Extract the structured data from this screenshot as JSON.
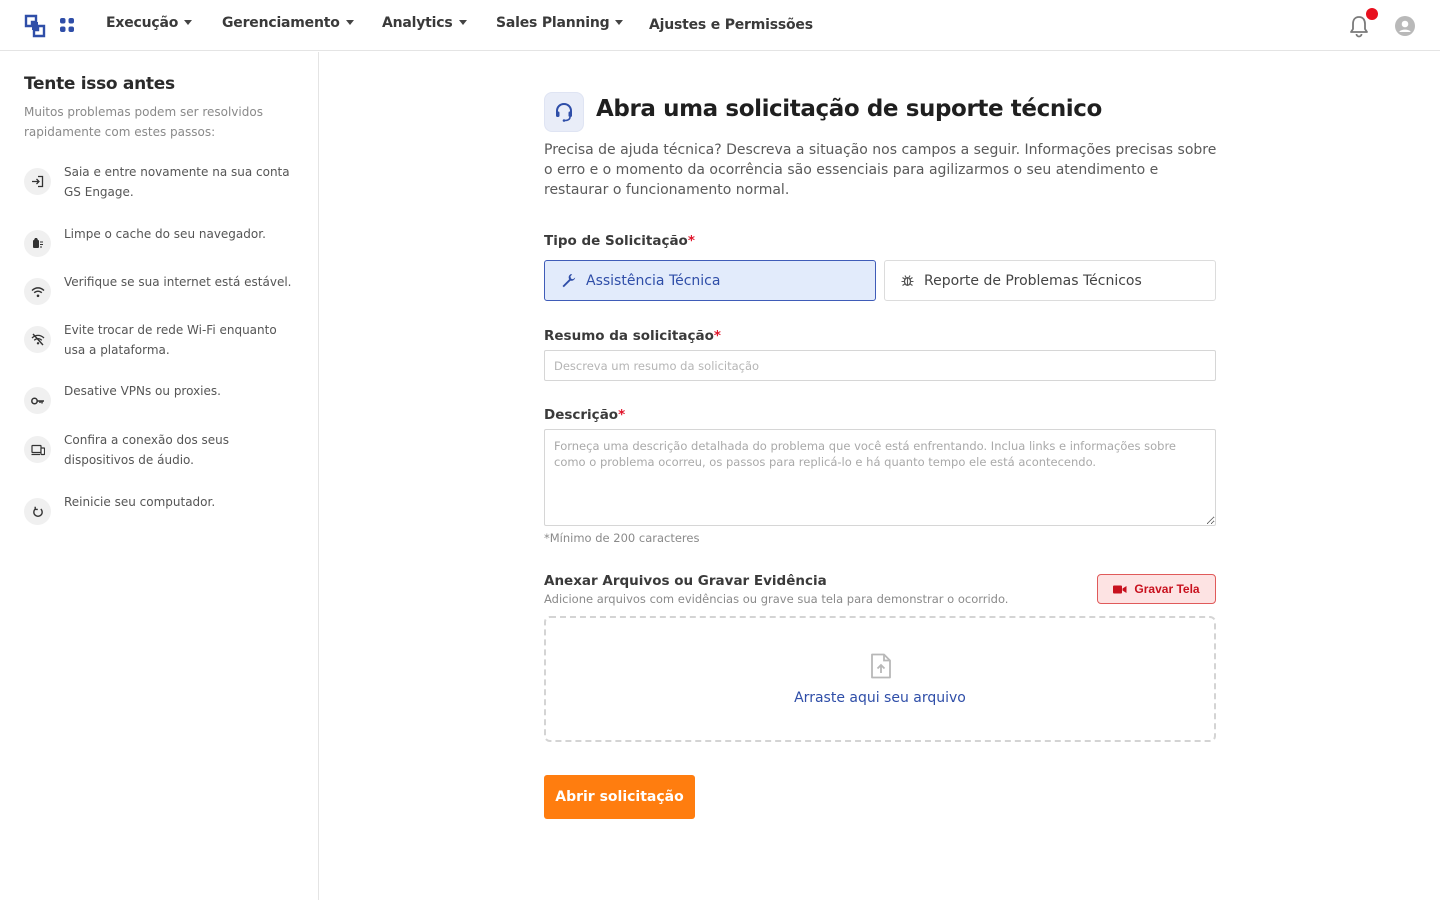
{
  "colors": {
    "brand": "#2f4ea8",
    "accent_orange": "#ff7d0f",
    "danger": "#e0142a",
    "notification_dot": "#e8101e"
  },
  "header": {
    "logo_icon": "logo-icon",
    "apps_icon": "apps-grid-icon",
    "nav": [
      {
        "label": "Execução",
        "has_dropdown": true
      },
      {
        "label": "Gerenciamento",
        "has_dropdown": true
      },
      {
        "label": "Analytics",
        "has_dropdown": true
      },
      {
        "label": "Sales Planning",
        "has_dropdown": true
      },
      {
        "label": "Ajustes e Permissões",
        "has_dropdown": false
      }
    ],
    "notification_icon": "bell-icon",
    "user_icon": "user-avatar-icon"
  },
  "sidebar": {
    "title": "Tente isso antes",
    "subtitle": "Muitos problemas podem ser resolvidos rapidamente com estes passos:",
    "tips": [
      {
        "icon": "login-icon",
        "text": "Saia e entre novamente na sua conta GS Engage."
      },
      {
        "icon": "clear-cache-icon",
        "text": "Limpe o cache do seu navegador."
      },
      {
        "icon": "wifi-icon",
        "text": "Verifique se sua internet está estável."
      },
      {
        "icon": "wifi-off-icon",
        "text": "Evite trocar de rede Wi-Fi enquanto usa a plataforma."
      },
      {
        "icon": "key-icon",
        "text": "Desative VPNs ou proxies."
      },
      {
        "icon": "devices-icon",
        "text": "Confira a conexão dos seus dispositivos de áudio."
      },
      {
        "icon": "restart-icon",
        "text": "Reinicie seu computador."
      }
    ]
  },
  "main": {
    "icon": "support-agent-icon",
    "title": "Abra uma solicitação de suporte técnico",
    "intro": "Precisa de ajuda técnica? Descreva a situação nos campos a seguir. Informações precisas sobre o erro e o momento da ocorrência são essenciais para agilizarmos o seu atendimento e restaurar o funcionamento normal.",
    "type": {
      "label": "Tipo de Solicitação",
      "required_mark": "*",
      "options": [
        {
          "label": "Assistência Técnica",
          "icon": "wrench-icon",
          "selected": true
        },
        {
          "label": "Reporte de Problemas Técnicos",
          "icon": "bug-icon",
          "selected": false
        }
      ]
    },
    "summary": {
      "label": "Resumo da solicitação",
      "required_mark": "*",
      "placeholder": "Descreva um resumo da solicitação",
      "value": ""
    },
    "description": {
      "label": "Descrição",
      "required_mark": "*",
      "placeholder": "Forneça uma descrição detalhada do problema que você está enfrentando. Inclua links e informações sobre como o problema ocorreu, os passos para replicá-lo e há quanto tempo ele está acontecendo.",
      "value": "",
      "hint": "*Mínimo de 200 caracteres"
    },
    "attachments": {
      "title": "Anexar Arquivos ou Gravar Evidência",
      "subtitle": "Adicione arquivos com evidências ou grave sua tela para demonstrar o ocorrido.",
      "record_label": "Gravar Tela",
      "record_icon": "video-camera-icon",
      "dropzone_icon": "file-upload-icon",
      "dropzone_text": "Arraste aqui seu arquivo"
    },
    "submit_label": "Abrir solicitação"
  }
}
